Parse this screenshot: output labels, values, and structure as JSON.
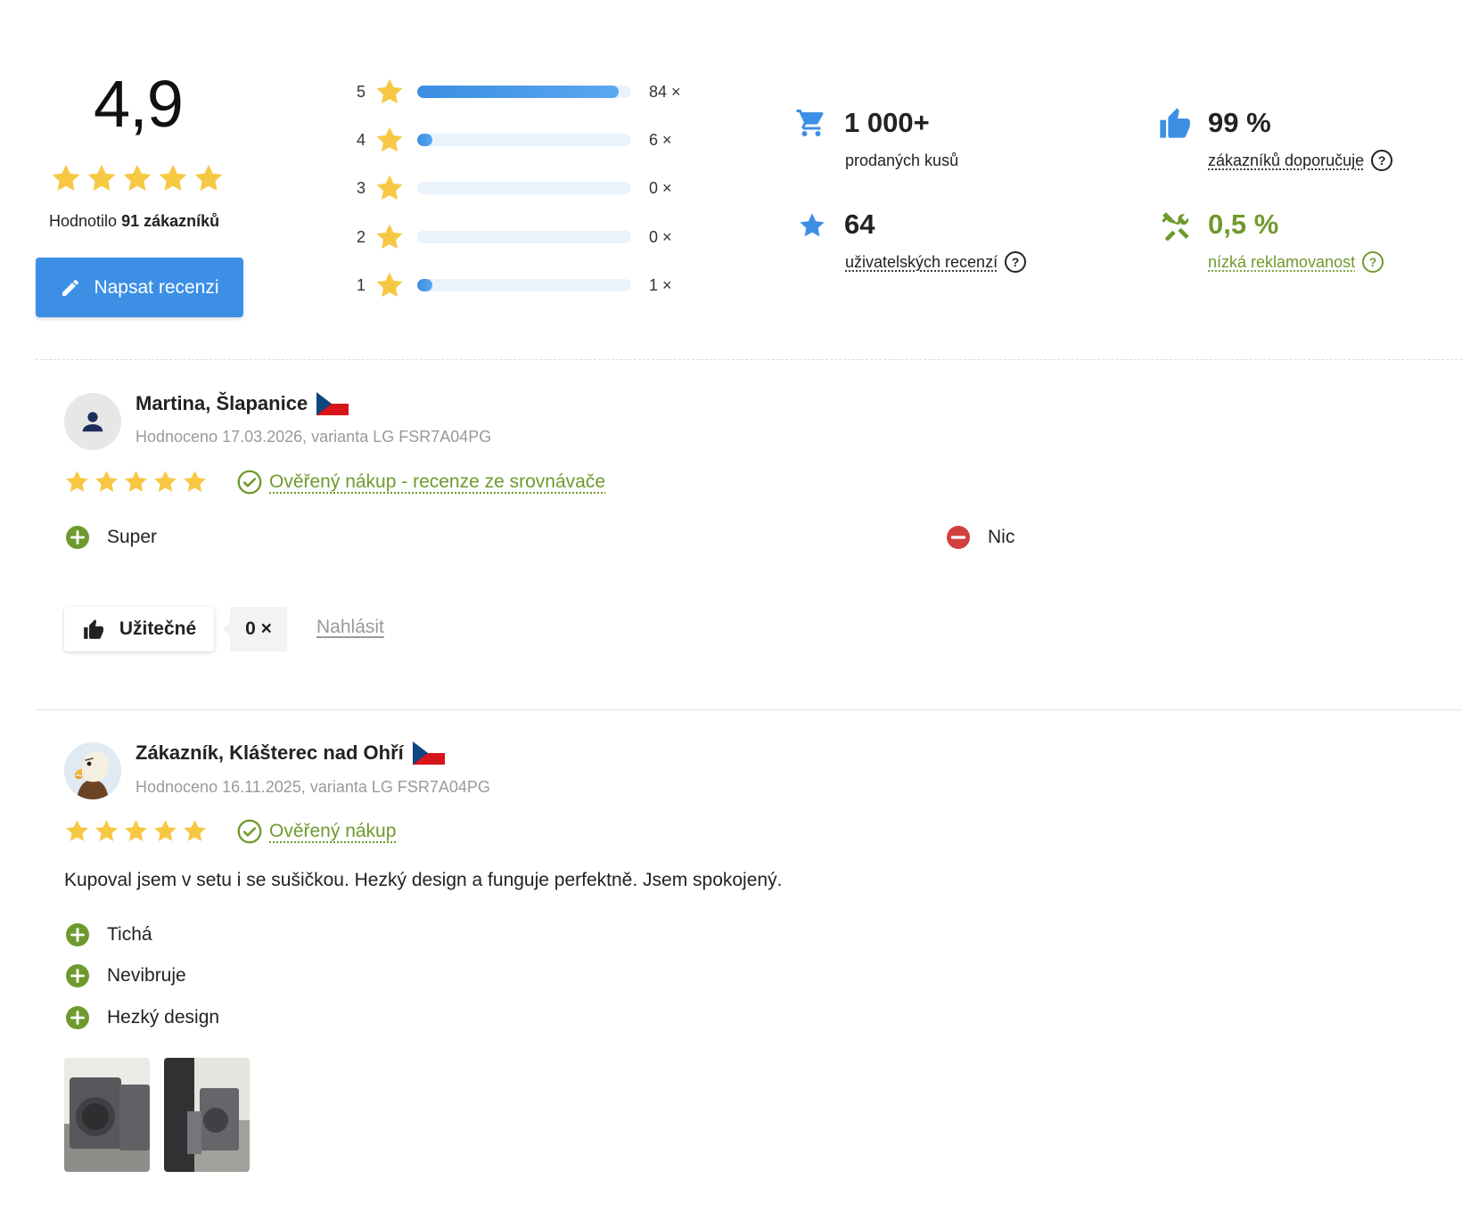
{
  "summary": {
    "average": "4,9",
    "stars": 5,
    "rated_by_prefix": "Hodnotilo ",
    "rated_by_count": "91 zákazníků",
    "write_review_label": "Napsat recenzi"
  },
  "distribution": [
    {
      "stars": "5",
      "count_label": "84 ×",
      "count": 84
    },
    {
      "stars": "4",
      "count_label": "6 ×",
      "count": 6
    },
    {
      "stars": "3",
      "count_label": "0 ×",
      "count": 0
    },
    {
      "stars": "2",
      "count_label": "0 ×",
      "count": 0
    },
    {
      "stars": "1",
      "count_label": "1 ×",
      "count": 1
    }
  ],
  "stats": {
    "sold_value": "1 000+",
    "sold_label": "prodaných kusů",
    "recommend_value": "99 %",
    "recommend_label": "zákazníků doporučuje",
    "reviews_value": "64",
    "reviews_label": "uživatelských recenzí",
    "complaints_value": "0,5 %",
    "complaints_label": "nízká reklamovanost",
    "help_glyph": "?"
  },
  "colors": {
    "accent_blue": "#3d8fe6",
    "star_yellow": "#f7c843",
    "green": "#6e9a2d",
    "red": "#d23f3f"
  },
  "reviews": [
    {
      "author": "Martina, Šlapanice",
      "meta": "Hodnoceno 17.03.2026, varianta LG FSR7A04PG",
      "rating": 5,
      "verified_label": "Ověřený nákup - recenze ze srovnávače",
      "pros": [
        "Super"
      ],
      "cons": [
        "Nic"
      ],
      "useful_label": "Užitečné",
      "useful_count": "0 ×",
      "report_label": "Nahlásit",
      "avatar": "person-icon"
    },
    {
      "author": "Zákazník, Klášterec nad Ohří",
      "meta": "Hodnoceno 16.11.2025, varianta LG FSR7A04PG",
      "rating": 5,
      "verified_label": "Ověřený nákup",
      "text": "Kupoval jsem v setu i se sušičkou. Hezký design a funguje perfektně. Jsem spokojený.",
      "pros": [
        "Tichá",
        "Nevibruje",
        "Hezký design"
      ],
      "avatar": "eagle-avatar",
      "photos": [
        "washer-photo",
        "washer-photo"
      ]
    }
  ]
}
